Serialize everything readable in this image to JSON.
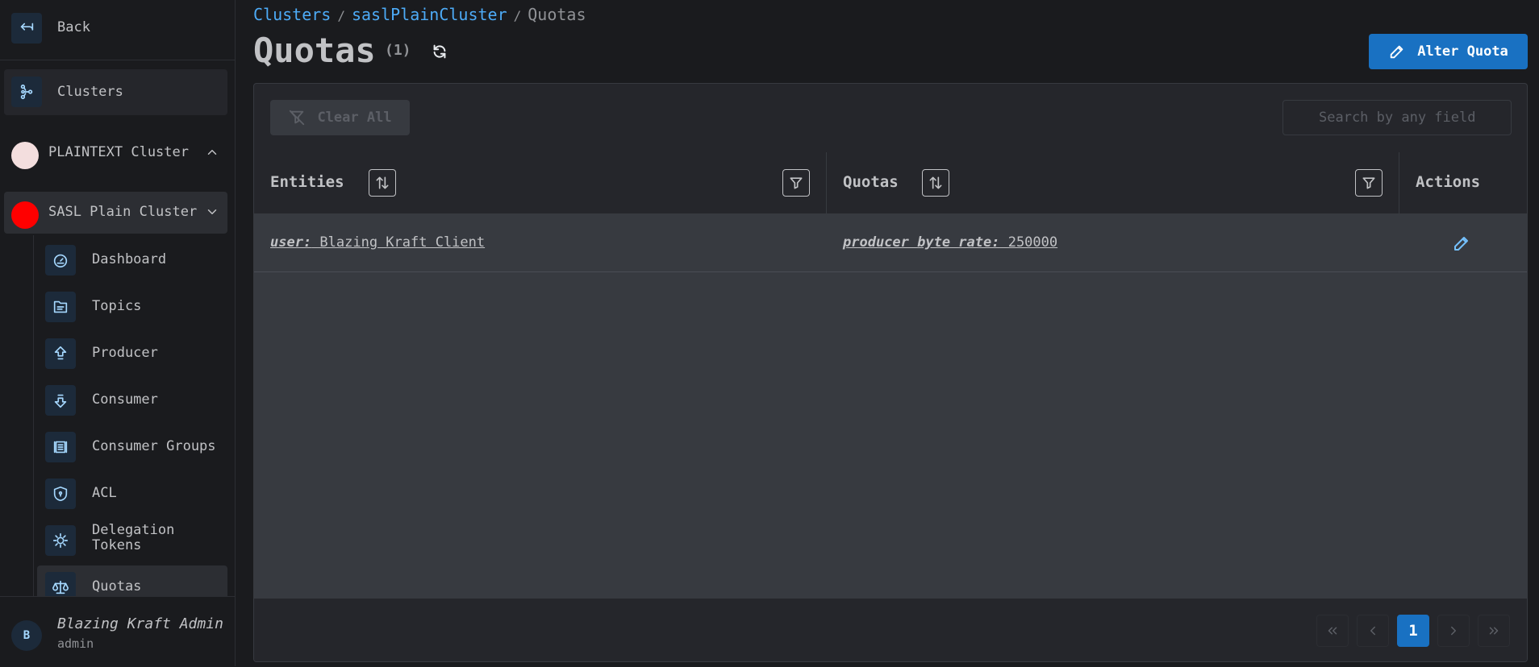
{
  "sidebar": {
    "back_label": "Back",
    "clusters_label": "Clusters",
    "clusters": [
      {
        "name": "PLAINTEXT Cluster",
        "color": "#f3dede",
        "expanded": false
      },
      {
        "name": "SASL Plain Cluster",
        "color": "#ff0000",
        "expanded": true
      }
    ],
    "nav_items": [
      {
        "label": "Dashboard",
        "icon": "dashboard-icon"
      },
      {
        "label": "Topics",
        "icon": "topics-icon"
      },
      {
        "label": "Producer",
        "icon": "producer-icon"
      },
      {
        "label": "Consumer",
        "icon": "consumer-icon"
      },
      {
        "label": "Consumer Groups",
        "icon": "consumer-groups-icon"
      },
      {
        "label": "ACL",
        "icon": "acl-shield-icon"
      },
      {
        "label": "Delegation Tokens",
        "icon": "delegation-tokens-icon"
      },
      {
        "label": "Quotas",
        "icon": "quotas-scale-icon",
        "active": true
      }
    ],
    "user": {
      "initial": "B",
      "name": "Blazing Kraft Admin",
      "role": "admin"
    }
  },
  "breadcrumb": {
    "items": [
      "Clusters",
      "saslPlainCluster",
      "Quotas"
    ],
    "separator": "/"
  },
  "page": {
    "title": "Quotas",
    "count": "(1)",
    "alter_button": "Alter Quota"
  },
  "toolbar": {
    "clear_all": "Clear All",
    "search_placeholder": "Search by any field"
  },
  "table": {
    "columns": [
      "Entities",
      "Quotas",
      "Actions"
    ],
    "rows": [
      {
        "entity_key": "user:",
        "entity_value": " Blazing Kraft Client",
        "quota_key": "producer byte rate:",
        "quota_value": " 250000"
      }
    ]
  },
  "pagination": {
    "current": "1"
  },
  "colors": {
    "accent": "#1971c2",
    "link": "#4dabf7",
    "background": "#1a1b1e"
  }
}
